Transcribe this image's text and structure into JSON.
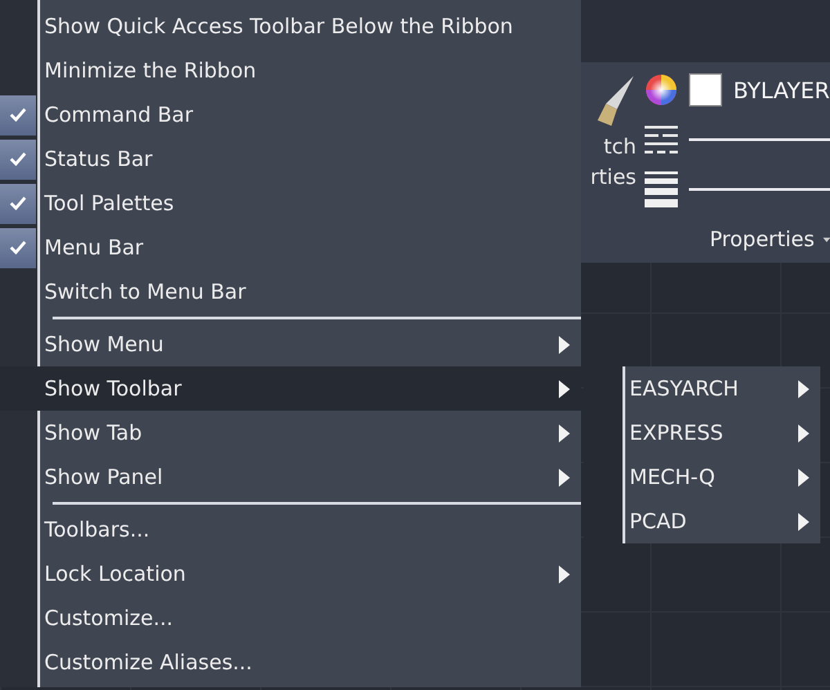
{
  "ribbon": {
    "match_text": [
      "tch",
      "rties"
    ],
    "color_value": "BYLAYER",
    "panel_title": "Properties"
  },
  "menu": {
    "items": [
      {
        "kind": "item",
        "label": "Show Quick Access Toolbar Below the Ribbon",
        "checked": false,
        "submenu": false,
        "selected": false
      },
      {
        "kind": "item",
        "label": "Minimize the Ribbon",
        "checked": false,
        "submenu": false,
        "selected": false
      },
      {
        "kind": "item",
        "label": "Command Bar",
        "checked": true,
        "submenu": false,
        "selected": false
      },
      {
        "kind": "item",
        "label": "Status Bar",
        "checked": true,
        "submenu": false,
        "selected": false
      },
      {
        "kind": "item",
        "label": "Tool Palettes",
        "checked": true,
        "submenu": false,
        "selected": false
      },
      {
        "kind": "item",
        "label": "Menu Bar",
        "checked": true,
        "submenu": false,
        "selected": false
      },
      {
        "kind": "item",
        "label": "Switch to Menu Bar",
        "checked": false,
        "submenu": false,
        "selected": false
      },
      {
        "kind": "separator"
      },
      {
        "kind": "item",
        "label": "Show Menu",
        "checked": false,
        "submenu": true,
        "selected": false
      },
      {
        "kind": "item",
        "label": "Show Toolbar",
        "checked": false,
        "submenu": true,
        "selected": true
      },
      {
        "kind": "item",
        "label": "Show Tab",
        "checked": false,
        "submenu": true,
        "selected": false
      },
      {
        "kind": "item",
        "label": "Show Panel",
        "checked": false,
        "submenu": true,
        "selected": false
      },
      {
        "kind": "separator"
      },
      {
        "kind": "item",
        "label": "Toolbars...",
        "checked": false,
        "submenu": false,
        "selected": false
      },
      {
        "kind": "item",
        "label": "Lock Location",
        "checked": false,
        "submenu": true,
        "selected": false
      },
      {
        "kind": "item",
        "label": "Customize...",
        "checked": false,
        "submenu": false,
        "selected": false
      },
      {
        "kind": "item",
        "label": "Customize Aliases...",
        "checked": false,
        "submenu": false,
        "selected": false
      }
    ]
  },
  "submenu": {
    "items": [
      {
        "label": "EASYARCH",
        "submenu": true
      },
      {
        "label": "EXPRESS",
        "submenu": true
      },
      {
        "label": "MECH-Q",
        "submenu": true
      },
      {
        "label": "PCAD",
        "submenu": true
      }
    ]
  }
}
